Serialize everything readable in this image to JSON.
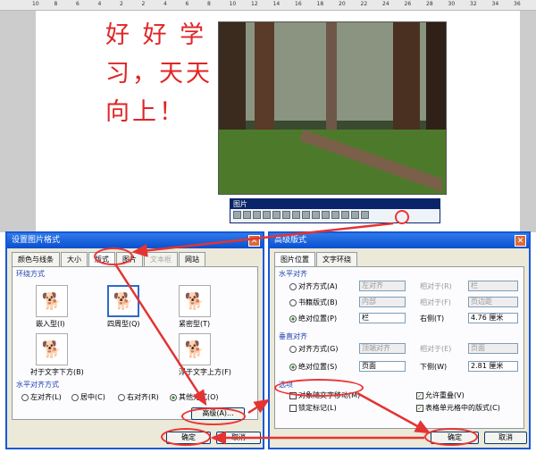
{
  "ruler": {
    "numbers": [
      "10",
      "8",
      "6",
      "4",
      "2",
      "2",
      "4",
      "6",
      "8",
      "10",
      "12",
      "14",
      "16",
      "18",
      "20",
      "22",
      "24",
      "26",
      "28",
      "30",
      "32",
      "34",
      "36"
    ]
  },
  "document": {
    "text_line1": "好 好 学",
    "text_line2": "习，天天",
    "text_line3": "向上！"
  },
  "picture_toolbar": {
    "title": "图片"
  },
  "format_dialog": {
    "title": "设置图片格式",
    "tabs": [
      "颜色与线条",
      "大小",
      "版式",
      "图片",
      "文本框",
      "网站"
    ],
    "wrap_section": "环绕方式",
    "wrap_options": [
      "嵌入型(I)",
      "四周型(Q)",
      "紧密型(T)",
      "衬于文字下方(B)",
      "浮于文字上方(F)"
    ],
    "halign_section": "水平对齐方式",
    "halign_options": [
      "左对齐(L)",
      "居中(C)",
      "右对齐(R)",
      "其他方式(O)"
    ],
    "advanced_label": "高级(A)...",
    "ok_label": "确定",
    "cancel_label": "取消"
  },
  "advanced_dialog": {
    "title": "高级版式",
    "tabs": [
      "图片位置",
      "文字环绕"
    ],
    "horizontal_section": "水平对齐",
    "h_align_label": "对齐方式(A)",
    "h_align_value": "左对齐",
    "h_relative_label": "相对于(R)",
    "h_relative_value": "栏",
    "h_book_label": "书籍版式(B)",
    "h_book_value": "内部",
    "h_book_rel_label": "相对于(F)",
    "h_book_rel_value": "页边距",
    "h_abs_label": "绝对位置(P)",
    "h_abs_value": "栏",
    "h_right_label": "右侧(T)",
    "h_right_value": "4.76 厘米",
    "vertical_section": "垂直对齐",
    "v_align_label": "对齐方式(G)",
    "v_align_value": "顶端对齐",
    "v_relative_label": "相对于(E)",
    "v_relative_value": "页面",
    "v_abs_label": "绝对位置(S)",
    "v_abs_value": "页面",
    "v_below_label": "下侧(W)",
    "v_below_value": "2.81 厘米",
    "options_section": "选项",
    "move_with_text": "对象随文字移动(M)",
    "lock_anchor": "锁定标记(L)",
    "allow_overlap": "允许重叠(V)",
    "table_cell": "表格单元格中的版式(C)",
    "ok_label": "确定",
    "cancel_label": "取消"
  },
  "colors": {
    "annotation": "#e33333",
    "title_bar": "#0a4fd0"
  }
}
